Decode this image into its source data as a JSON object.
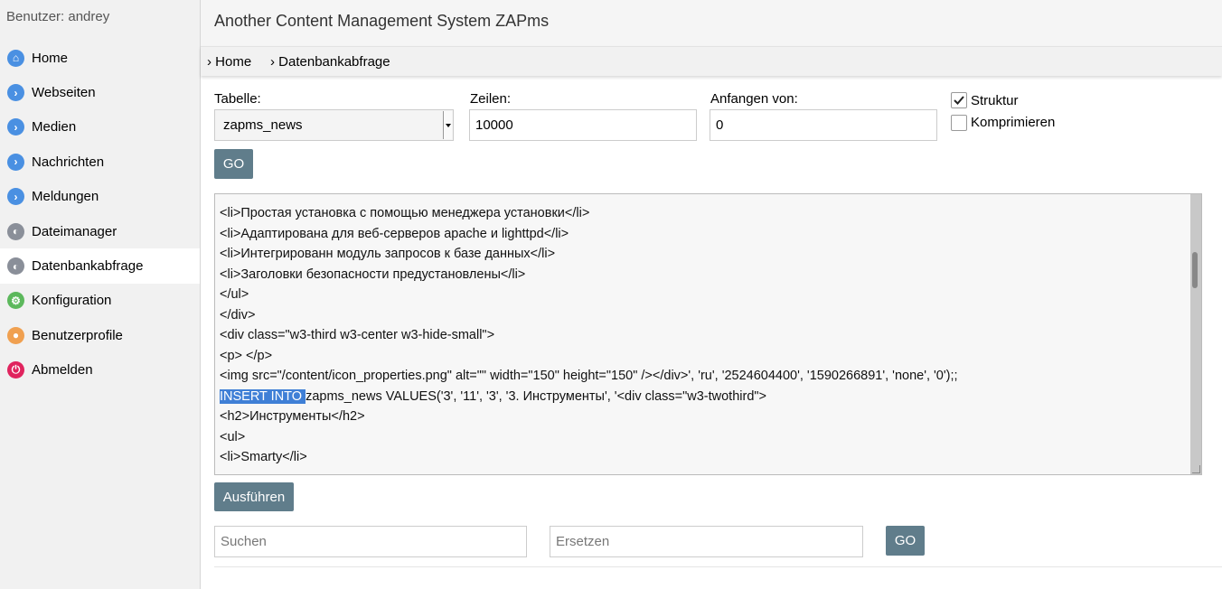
{
  "sidebar": {
    "user_label": "Benutzer: andrey",
    "items": [
      {
        "label": "Home",
        "icon": "home-icon",
        "color": "#4a90e2",
        "glyph": "⌂"
      },
      {
        "label": "Webseiten",
        "icon": "chevron-right-icon",
        "color": "#4a90e2",
        "glyph": "›"
      },
      {
        "label": "Medien",
        "icon": "chevron-right-icon",
        "color": "#4a90e2",
        "glyph": "›"
      },
      {
        "label": "Nachrichten",
        "icon": "chevron-right-icon",
        "color": "#4a90e2",
        "glyph": "›"
      },
      {
        "label": "Meldungen",
        "icon": "chevron-right-icon",
        "color": "#4a90e2",
        "glyph": "›"
      },
      {
        "label": "Dateimanager",
        "icon": "tool-icon",
        "color": "#8a8f99",
        "glyph": "◐"
      },
      {
        "label": "Datenbankabfrage",
        "icon": "tool-icon",
        "color": "#8a8f99",
        "glyph": "◐"
      },
      {
        "label": "Konfiguration",
        "icon": "gear-icon",
        "color": "#5cb85c",
        "glyph": "⚙"
      },
      {
        "label": "Benutzerprofile",
        "icon": "user-icon",
        "color": "#f0a050",
        "glyph": "●"
      },
      {
        "label": "Abmelden",
        "icon": "power-icon",
        "color": "#e0245e",
        "glyph": "⏻"
      }
    ],
    "active_index": 6
  },
  "header": {
    "title": "Another Content Management System ZAPms"
  },
  "breadcrumb": {
    "items": [
      "› Home",
      "› Datenbankabfrage"
    ]
  },
  "form": {
    "tabelle_label": "Tabelle:",
    "tabelle_value": "zapms_news",
    "zeilen_label": "Zeilen:",
    "zeilen_value": "10000",
    "anfangen_label": "Anfangen von:",
    "anfangen_value": "0",
    "struktur_label": "Struktur",
    "struktur_checked": true,
    "komprimieren_label": "Komprimieren",
    "komprimieren_checked": false,
    "go_label": "GO"
  },
  "editor": {
    "lines": [
      "<li>Простая установка с помощью менеджера установки</li>",
      "<li>Адаптирована для веб-серверов apache и lighttpd</li>",
      "<li>Интегрированн модуль запросов к базе данных</li>",
      "<li>Заголовки безопасности предустановлены</li>",
      "</ul>",
      "</div>",
      "<div class=\"w3-third w3-center w3-hide-small\">",
      "<p> </p>",
      "<img src=\"/content/icon_properties.png\" alt=\"\" width=\"150\" height=\"150\" /></div>', 'ru', '2524604400', '1590266891', 'none', '0');;",
      "zapms_news VALUES('3', '11', '3', '3. Инструменты', '<div class=\"w3-twothird\">",
      "<h2>Инструменты</h2>",
      "<ul>",
      "<li>Smarty</li>"
    ],
    "selected_text": "INSERT INTO ",
    "selected_line_index": 9
  },
  "actions": {
    "execute_label": "Ausführen",
    "search_placeholder": "Suchen",
    "replace_placeholder": "Ersetzen",
    "go_label": "GO"
  }
}
